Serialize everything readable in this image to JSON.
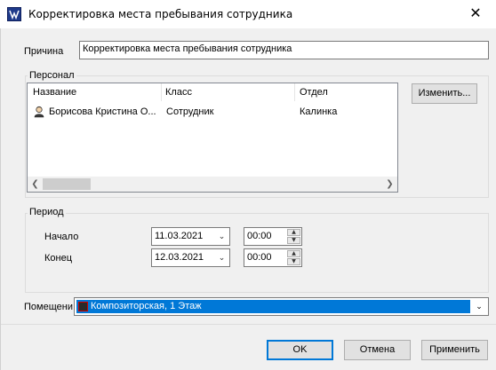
{
  "window": {
    "title": "Корректировка места пребывания сотрудника",
    "close_glyph": "✕"
  },
  "reason": {
    "label": "Причина",
    "value": "Корректировка места пребывания сотрудника"
  },
  "personnel": {
    "group_title": "Персонал",
    "columns": [
      "Название",
      "Класс",
      "Отдел"
    ],
    "rows": [
      {
        "name": "Борисова Кристина О...",
        "class": "Сотрудник",
        "dept": "Калинка",
        "icon": "person-icon"
      }
    ],
    "change_button": "Изменить..."
  },
  "period": {
    "group_title": "Период",
    "start_label": "Начало",
    "start_date": "11.03.2021",
    "start_time": "00:00",
    "end_label": "Конец",
    "end_date": "12.03.2021",
    "end_time": "00:00"
  },
  "room": {
    "label": "Помещени",
    "value": "Композиторская, 1 Этаж",
    "icon": "room-icon"
  },
  "buttons": {
    "ok": "OK",
    "cancel": "Отмена",
    "apply": "Применить"
  },
  "colors": {
    "selection": "#0078d7",
    "default_button_border": "#0078d7"
  }
}
